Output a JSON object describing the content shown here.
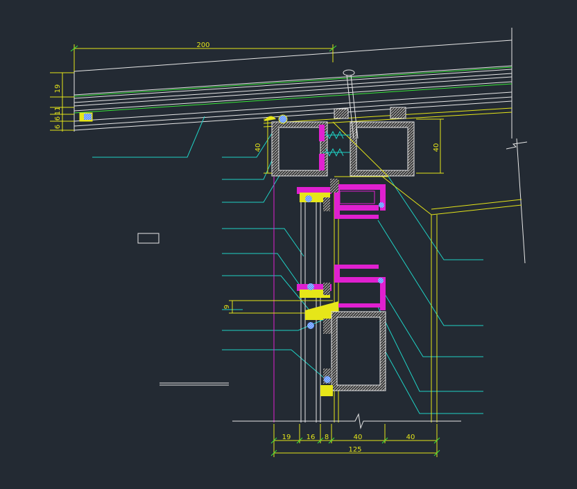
{
  "colors": {
    "background": "#232a33",
    "white": "#e8e8e8",
    "yellow": "#e6e619",
    "green": "#38e838",
    "cyan": "#1fd3c6",
    "magenta": "#e020d0",
    "blue": "#3a7cff",
    "hatch": "#cfcfcf"
  },
  "dimensions": {
    "top_width": "200",
    "left_stack": [
      "19",
      "11",
      "6",
      "6"
    ],
    "frame_left": "40",
    "frame_right": "40",
    "gap": "9",
    "bottom_segments": [
      "19",
      "16",
      "8",
      "40",
      "40"
    ],
    "bottom_total": "125"
  }
}
